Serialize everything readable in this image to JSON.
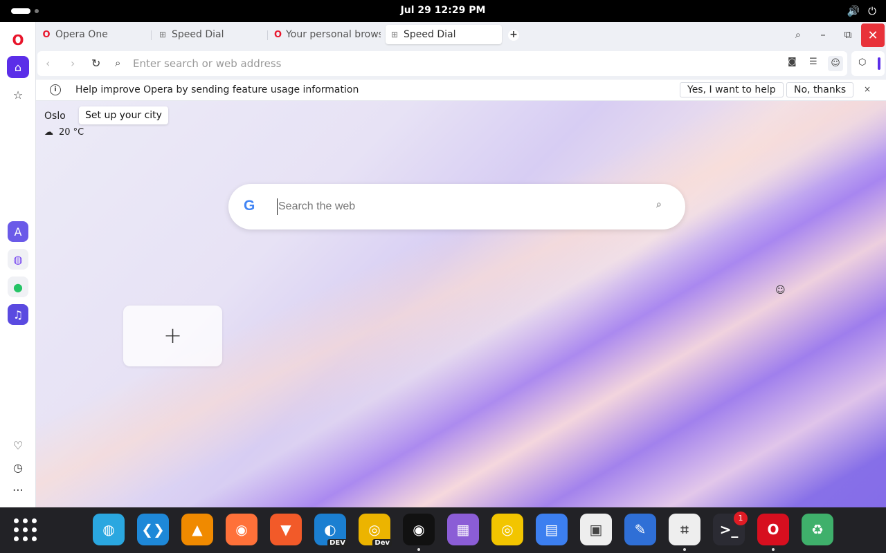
{
  "system": {
    "clock": "Jul 29  12:29 PM",
    "volume_icon": "volume-icon",
    "power_icon": "power-icon"
  },
  "tabs": [
    {
      "label": "Opera One",
      "icon": "opera-icon"
    },
    {
      "label": "Speed Dial",
      "icon": "grid-icon"
    },
    {
      "label": "Your personal brows",
      "icon": "opera-icon"
    },
    {
      "label": "Speed Dial",
      "icon": "grid-icon",
      "active": true
    }
  ],
  "address_bar": {
    "placeholder": "Enter search or web address",
    "value": ""
  },
  "infobar": {
    "message": "Help improve Opera by sending feature usage information",
    "yes_label": "Yes, I want to help",
    "no_label": "No, thanks",
    "close_glyph": "×"
  },
  "weather": {
    "city": "Oslo",
    "setup_tip": "Set up your city",
    "temperature": "20 °C"
  },
  "web_search": {
    "placeholder": "Search the web",
    "engine_logo": "G"
  },
  "speed_dial": {
    "add_glyph": "+"
  },
  "sidebar": {
    "items": [
      "opera-icon",
      "home-icon",
      "star-icon",
      "aria-icon",
      "messenger-icon",
      "whatsapp-icon",
      "music-player-icon",
      "heart-icon",
      "history-icon",
      "more-icon"
    ]
  },
  "dock": {
    "apps": [
      {
        "name": "browser-globe",
        "color": "#2aa7e0"
      },
      {
        "name": "vscode",
        "color": "#1e88d8"
      },
      {
        "name": "vlc",
        "color": "#f08a00"
      },
      {
        "name": "firefox",
        "color": "#ff7139"
      },
      {
        "name": "brave",
        "color": "#f25a29"
      },
      {
        "name": "edge-dev",
        "color": "#1b7fd1",
        "label": "DEV"
      },
      {
        "name": "chrome-dev",
        "color": "#ecb400",
        "label": "Dev"
      },
      {
        "name": "obs",
        "color": "#111111"
      },
      {
        "name": "calendar",
        "color": "#8b5dd6"
      },
      {
        "name": "rhythmbox",
        "color": "#f2c500"
      },
      {
        "name": "file-cabinet",
        "color": "#3c7ff0"
      },
      {
        "name": "software-store",
        "color": "#eeeeee"
      },
      {
        "name": "text-editor",
        "color": "#2f6fd6"
      },
      {
        "name": "screenshot-tool",
        "color": "#eeeeee"
      },
      {
        "name": "terminal",
        "color": "#2b2b33"
      },
      {
        "name": "opera",
        "color": "#d70f1f"
      },
      {
        "name": "trash",
        "color": "#3fb06b"
      }
    ],
    "terminal_badge": "1"
  },
  "accent_color": "#5b2ee8"
}
